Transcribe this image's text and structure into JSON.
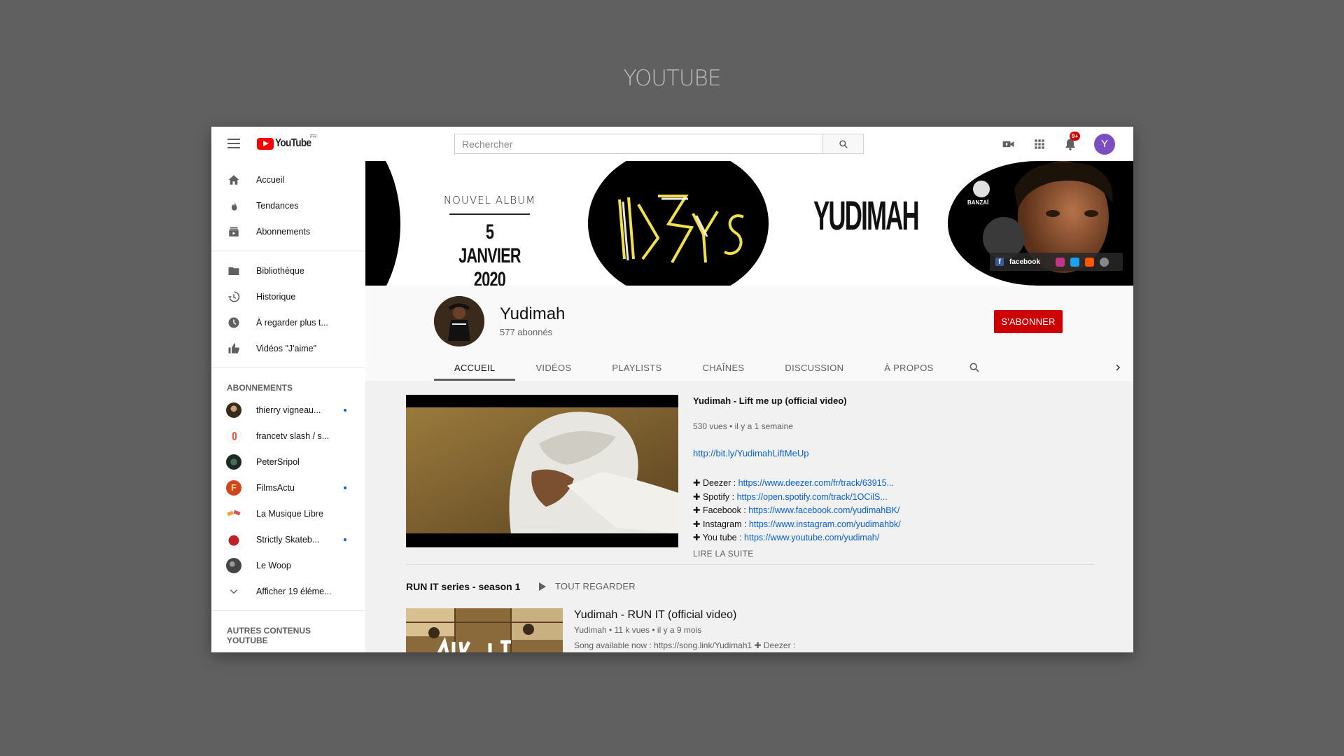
{
  "page_caption": "YOUTUBE",
  "header": {
    "logo_text": "YouTube",
    "country": "FR",
    "search_placeholder": "Rechercher",
    "notification_count": "9+",
    "avatar_letter": "Y",
    "avatar_color": "#7b4cc2"
  },
  "sidebar": {
    "main": [
      {
        "label": "Accueil",
        "icon": "home-icon"
      },
      {
        "label": "Tendances",
        "icon": "flame-icon"
      },
      {
        "label": "Abonnements",
        "icon": "subscriptions-icon"
      }
    ],
    "library": [
      {
        "label": "Bibliothèque",
        "icon": "folder-icon"
      },
      {
        "label": "Historique",
        "icon": "history-icon"
      },
      {
        "label": "À regarder plus t...",
        "icon": "clock-icon"
      },
      {
        "label": "Vidéos \"J'aime\"",
        "icon": "thumbs-up-icon"
      }
    ],
    "subscriptions_heading": "ABONNEMENTS",
    "subscriptions": [
      {
        "label": "thierry vigneau...",
        "new": true,
        "color": "#3a2a1a"
      },
      {
        "label": "francetv slash / s...",
        "new": false,
        "color": "#e85a4a"
      },
      {
        "label": "PeterSripol",
        "new": false,
        "color": "#1b3a2a"
      },
      {
        "label": "FilmsActu",
        "new": true,
        "color": "#d0451b"
      },
      {
        "label": "La Musique Libre",
        "new": false,
        "color": "#f0a040"
      },
      {
        "label": "Strictly Skateb...",
        "new": true,
        "color": "#c0202a"
      },
      {
        "label": "Le Woop",
        "new": false,
        "color": "#444444"
      }
    ],
    "show_more": "Afficher 19 éléme...",
    "other_heading": "AUTRES CONTENUS YOUTUBE"
  },
  "banner": {
    "album_line1": "NOUVEL ALBUM",
    "album_line2": "5 JANVIER 2020",
    "artist_name": "YUDIMAH",
    "facebook_label": "facebook"
  },
  "channel": {
    "name": "Yudimah",
    "subscribers": "577 abonnés",
    "subscribe_label": "S'ABONNER",
    "subscribe_color": "#cc0000",
    "tabs": [
      "ACCUEIL",
      "VIDÉOS",
      "PLAYLISTS",
      "CHAÎNES",
      "DISCUSSION",
      "À PROPOS"
    ]
  },
  "featured": {
    "title": "Yudimah - Lift me up (official video)",
    "meta": "530 vues • il y a 1 semaine",
    "link": "http://bit.ly/YudimahLiftMeUp",
    "lines": [
      {
        "label": "✚ Deezer : ",
        "url": "https://www.deezer.com/fr/track/63915..."
      },
      {
        "label": "✚ Spotify : ",
        "url": "https://open.spotify.com/track/1OCilS..."
      },
      {
        "label": "✚ Facebook : ",
        "url": "https://www.facebook.com/yudimahBK/"
      },
      {
        "label": "✚ Instagram : ",
        "url": "https://www.instagram.com/yudimahbk/"
      },
      {
        "label": "✚ You tube : ",
        "url": "https://www.youtube.com/yudimah/"
      }
    ],
    "read_more": "LIRE LA SUITE"
  },
  "shelf": {
    "title": "RUN IT series - season 1",
    "play_all": "TOUT REGARDER",
    "video": {
      "title": "Yudimah - RUN IT (official video)",
      "meta": "Yudimah • 11 k vues • il y a 9 mois",
      "description": "Song available now : https://song.link/Yudimah1 ✚ Deezer :"
    }
  }
}
